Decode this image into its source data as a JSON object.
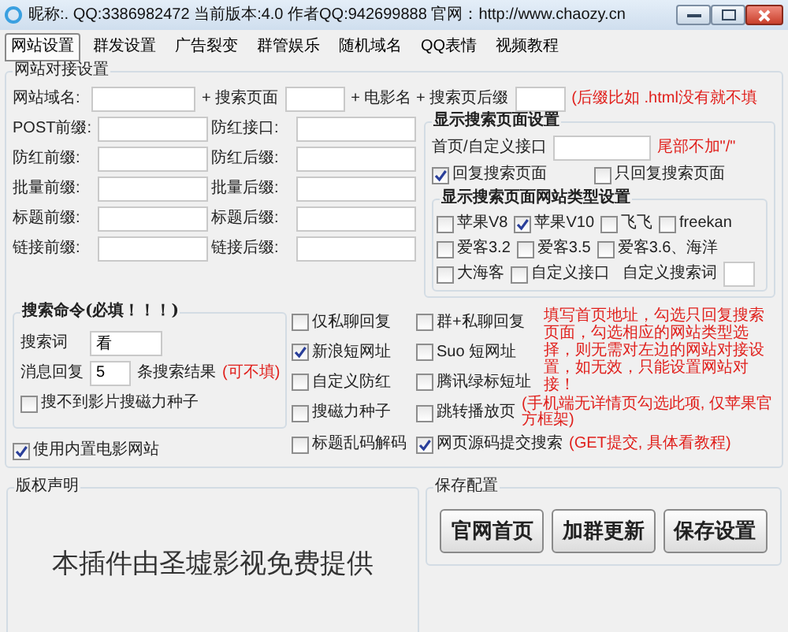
{
  "window": {
    "title": "昵称:. QQ:3386982472 当前版本:4.0 作者QQ:942699888 官网：http://www.chaozy.cn"
  },
  "tabs": [
    {
      "label": "网站设置",
      "selected": true
    },
    {
      "label": "群发设置",
      "selected": false
    },
    {
      "label": "广告裂变",
      "selected": false
    },
    {
      "label": "群管娱乐",
      "selected": false
    },
    {
      "label": "随机域名",
      "selected": false
    },
    {
      "label": "QQ表情",
      "selected": false
    },
    {
      "label": "视频教程",
      "selected": false
    }
  ],
  "site_settings": {
    "title": "网站对接设置",
    "url_row": {
      "label": "网站域名:",
      "search_page_label": "+ 搜索页面",
      "movie_label": "+ 电影名 + 搜索页后缀",
      "note": "(后缀比如 .html没有就不填"
    },
    "field_rows": [
      {
        "left": "POST前缀:",
        "right": "防红接口:"
      },
      {
        "left": "防红前缀:",
        "right": "防红后缀:"
      },
      {
        "left": "批量前缀:",
        "right": "批量后缀:"
      },
      {
        "left": "标题前缀:",
        "right": "标题后缀:"
      },
      {
        "left": "链接前缀:",
        "right": "链接后缀:"
      }
    ],
    "search_display": {
      "title": "显示搜索页面设置",
      "homepage_label": "首页/自定义接口",
      "homepage_note": "尾部不加\"/\"",
      "options": [
        {
          "label": "回复搜索页面",
          "checked": true
        },
        {
          "label": "只回复搜索页面",
          "checked": false
        }
      ],
      "site_types": {
        "title": "显示搜索页面网站类型设置",
        "rows": [
          [
            {
              "label": "苹果V8",
              "checked": false
            },
            {
              "label": "苹果V10",
              "checked": true
            },
            {
              "label": "飞飞",
              "checked": false
            },
            {
              "label": "freekan",
              "checked": false
            }
          ],
          [
            {
              "label": "爱客3.2",
              "checked": false
            },
            {
              "label": "爱客3.5",
              "checked": false
            },
            {
              "label": "爱客3.6、海洋",
              "checked": false
            }
          ],
          [
            {
              "label": "大海客",
              "checked": false
            },
            {
              "label": "自定义接口",
              "checked": false
            }
          ]
        ],
        "custom_keyword_label": "自定义搜索词"
      }
    },
    "note": "填写首页地址，勾选只回复搜索页面，勾选相应的网站类型选择，则无需对左边的网站对接设置，如无效，只能设置网站对接！",
    "search_command": {
      "title": "搜索命令(必填！！！)",
      "keyword_label": "搜索词",
      "keyword_value": "看",
      "reply_label": "消息回复",
      "reply_value": "5",
      "reply_unit": "条搜索结果",
      "reply_note": "(可不填)",
      "magnet": {
        "label": "搜不到影片搜磁力种子",
        "checked": false
      }
    },
    "builtin_sites": {
      "label": "使用内置电影网站",
      "checked": true
    },
    "options": [
      {
        "items": [
          {
            "label": "仅私聊回复",
            "checked": false
          },
          {
            "label": "群+私聊回复",
            "checked": false
          }
        ]
      },
      {
        "items": [
          {
            "label": "新浪短网址",
            "checked": true
          },
          {
            "label": "Suo 短网址",
            "checked": false
          }
        ]
      },
      {
        "items": [
          {
            "label": "自定义防红",
            "checked": false
          },
          {
            "label": "腾讯绿标短址",
            "checked": false
          }
        ]
      },
      {
        "items": [
          {
            "label": "搜磁力种子",
            "checked": false
          },
          {
            "label": "跳转播放页",
            "checked": false
          }
        ],
        "note": "(手机端无详情页勾选此项, 仅苹果官方框架)"
      },
      {
        "items": [
          {
            "label": "标题乱码解码",
            "checked": false
          },
          {
            "label": "网页源码提交搜索",
            "checked": true
          }
        ],
        "note": "(GET提交, 具体看教程)"
      }
    ]
  },
  "copyright": {
    "title": "版权声明",
    "text": "本插件由圣墟影视免费提供"
  },
  "save": {
    "title": "保存配置",
    "buttons": [
      "官网首页",
      "加群更新",
      "保存设置"
    ]
  }
}
